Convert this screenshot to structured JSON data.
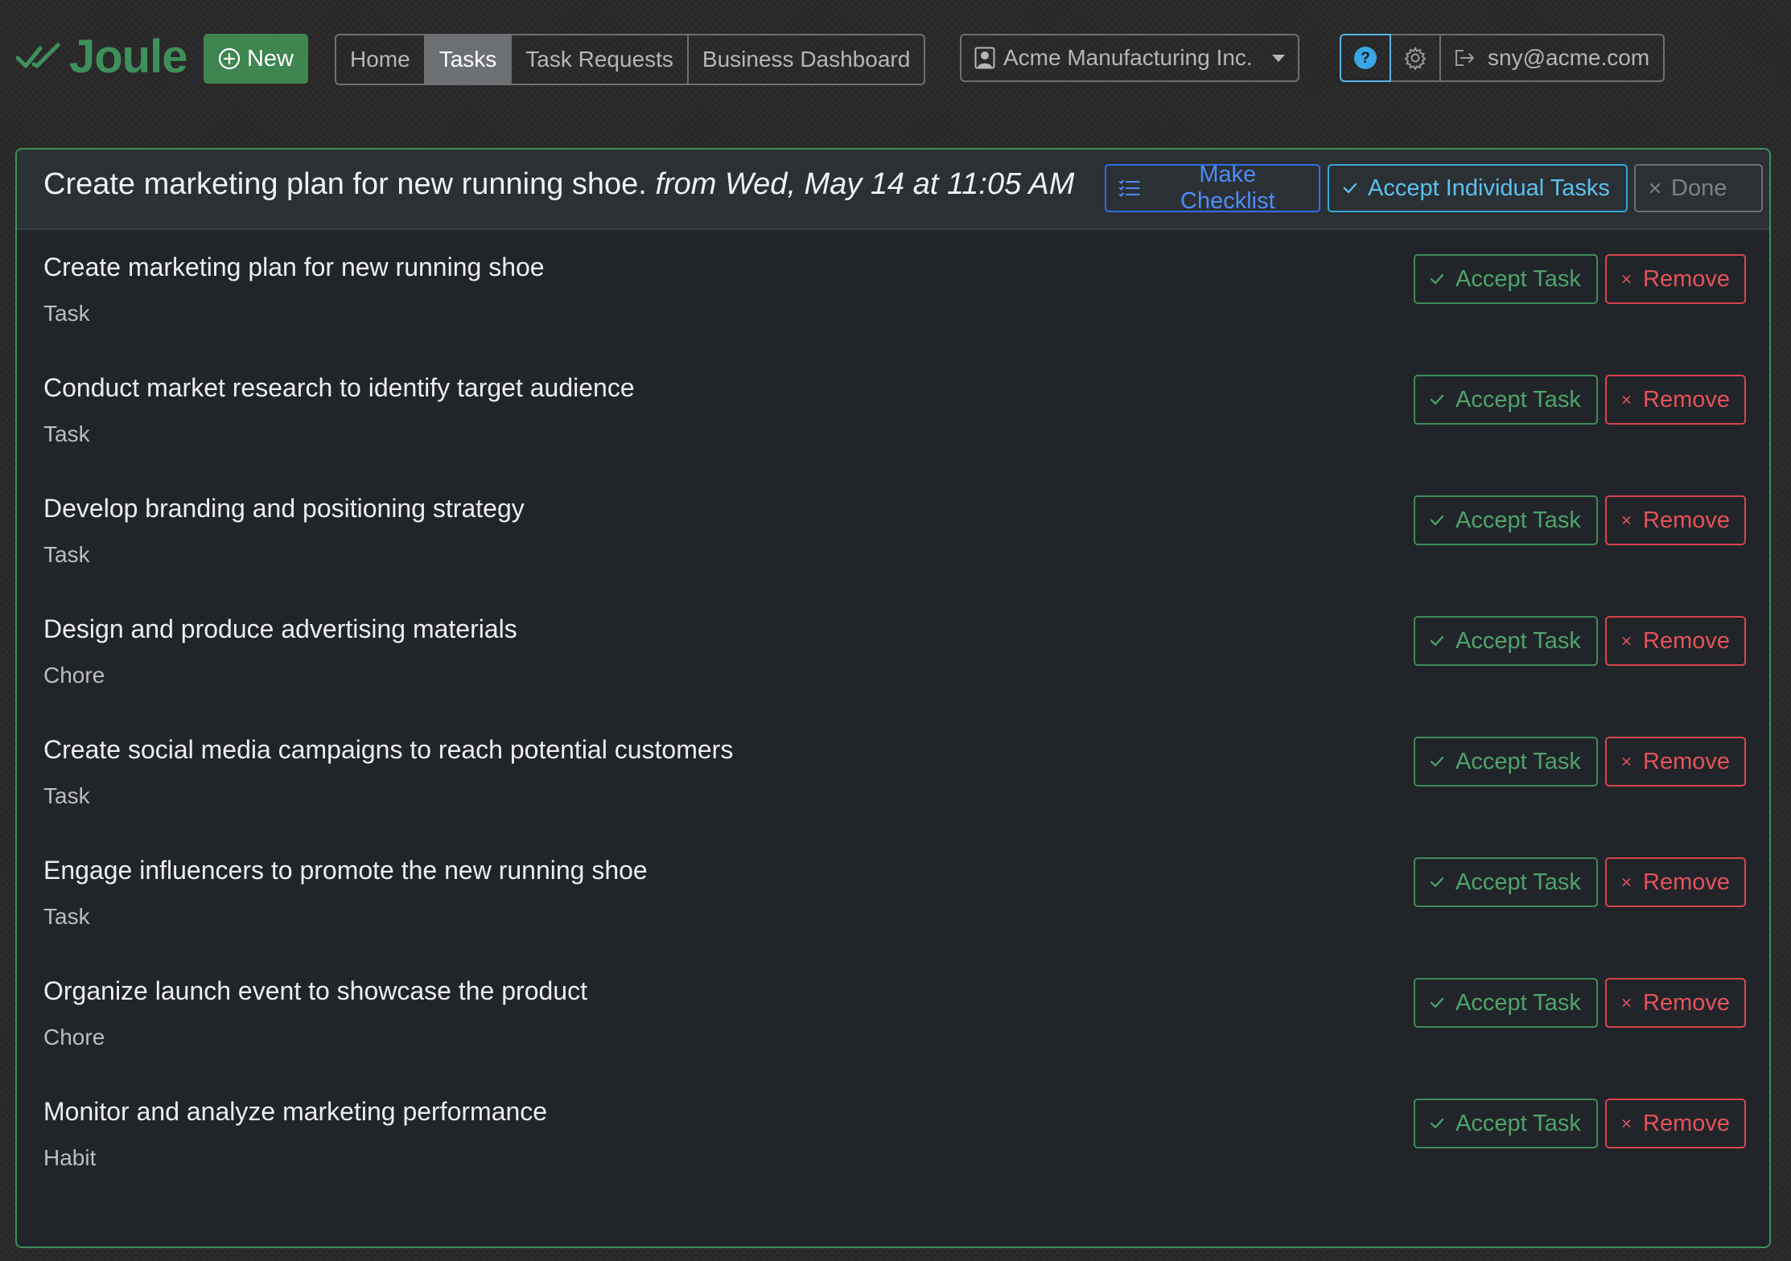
{
  "app": {
    "brand": "Joule",
    "new_button": "New",
    "colors": {
      "brand_green": "#3f8f5c",
      "accent_blue": "#4d8df5",
      "accent_cyan": "#5cc1ec",
      "danger_red": "#e5525b",
      "card_bg": "#212529"
    }
  },
  "nav": {
    "items": [
      {
        "label": "Home",
        "active": false
      },
      {
        "label": "Tasks",
        "active": true
      },
      {
        "label": "Task Requests",
        "active": false
      },
      {
        "label": "Business Dashboard",
        "active": false
      }
    ]
  },
  "org": {
    "selected": "Acme Manufacturing Inc.",
    "icon": "user-square-icon"
  },
  "user": {
    "email": "sny@acme.com",
    "help_icon": "question-circle-icon",
    "settings_icon": "gear-icon",
    "logout_icon": "box-arrow-right-icon"
  },
  "request": {
    "title": "Create marketing plan for new running shoe.",
    "subtitle": "from Wed, May 14 at 11:05 AM",
    "make_checklist": "Make Checklist",
    "accept_individual": "Accept Individual Tasks",
    "done": "Done"
  },
  "task_buttons": {
    "accept": "Accept Task",
    "remove": "Remove"
  },
  "tasks": [
    {
      "title": "Create marketing plan for new running shoe",
      "type": "Task"
    },
    {
      "title": "Conduct market research to identify target audience",
      "type": "Task"
    },
    {
      "title": "Develop branding and positioning strategy",
      "type": "Task"
    },
    {
      "title": "Design and produce advertising materials",
      "type": "Chore"
    },
    {
      "title": "Create social media campaigns to reach potential customers",
      "type": "Task"
    },
    {
      "title": "Engage influencers to promote the new running shoe",
      "type": "Task"
    },
    {
      "title": "Organize launch event to showcase the product",
      "type": "Chore"
    },
    {
      "title": "Monitor and analyze marketing performance",
      "type": "Habit"
    }
  ]
}
